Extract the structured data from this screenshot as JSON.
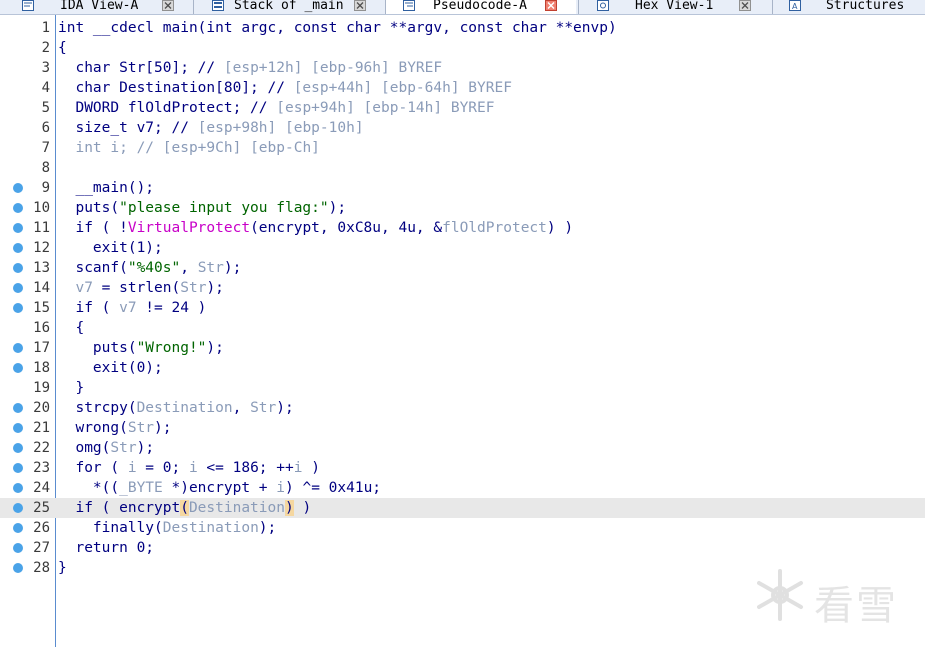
{
  "tabs": [
    {
      "label": "IDA View-A",
      "icon": "disassembly-icon",
      "active": false
    },
    {
      "label": "Stack of _main",
      "icon": "stack-icon",
      "active": false
    },
    {
      "label": "Pseudocode-A",
      "icon": "pseudocode-icon",
      "active": true
    },
    {
      "label": "Hex View-1",
      "icon": "hex-icon",
      "active": false
    },
    {
      "label": "Structures",
      "icon": "structures-icon",
      "active": false
    }
  ],
  "colors": {
    "keyword": "#000080",
    "comment": "#8a9bb8",
    "string": "#006400",
    "import": "#c800c8",
    "breakpoint": "#4aa3e8",
    "gutter_line": "#5a8ccf"
  },
  "code": {
    "line_numbers": [
      "1",
      "2",
      "3",
      "4",
      "5",
      "6",
      "7",
      "8",
      "9",
      "10",
      "11",
      "12",
      "13",
      "14",
      "15",
      "16",
      "17",
      "18",
      "19",
      "20",
      "21",
      "22",
      "23",
      "24",
      "25",
      "26",
      "27",
      "28"
    ],
    "l1": "int __cdecl main(int argc, const char **argv, const char **envp)",
    "l2": "{",
    "l3a": "  char Str[50]; // ",
    "l3b": "[esp+12h] [ebp-96h] BYREF",
    "l4a": "  char Destination[80]; // ",
    "l4b": "[esp+44h] [ebp-64h] BYREF",
    "l5a": "  DWORD flOldProtect; // ",
    "l5b": "[esp+94h] [ebp-14h] BYREF",
    "l6a": "  size_t v7; // ",
    "l6b": "[esp+98h] [ebp-10h]",
    "l7a": "  int i; // ",
    "l7b": "[esp+9Ch] [ebp-Ch]",
    "l9": "  __main();",
    "l10a": "  puts(",
    "l10b": "\"please input you flag:\"",
    "l10c": ");",
    "l11a": "  if ( !",
    "l11b": "VirtualProtect",
    "l11c": "(encrypt, 0xC8u, 4u, &",
    "l11d": "flOldProtect",
    "l11e": ") )",
    "l12": "    exit(1);",
    "l13a": "  scanf(",
    "l13b": "\"%40s\"",
    "l13c": ", ",
    "l13d": "Str",
    "l13e": ");",
    "l14a": "  ",
    "l14b": "v7",
    "l14c": " = strlen(",
    "l14d": "Str",
    "l14e": ");",
    "l15a": "  if ( ",
    "l15b": "v7",
    "l15c": " != 24 )",
    "l16": "  {",
    "l17a": "    puts(",
    "l17b": "\"Wrong!\"",
    "l17c": ");",
    "l18": "    exit(0);",
    "l19": "  }",
    "l20a": "  strcpy(",
    "l20b": "Destination",
    "l20c": ", ",
    "l20d": "Str",
    "l20e": ");",
    "l21a": "  wrong(",
    "l21b": "Str",
    "l21c": ");",
    "l22a": "  omg(",
    "l22b": "Str",
    "l22c": ");",
    "l23a": "  for ( ",
    "l23b": "i",
    "l23c": " = 0; ",
    "l23d": "i",
    "l23e": " <= 186; ++",
    "l23f": "i",
    "l23g": " )",
    "l24a": "    *((",
    "l24b": "_BYTE",
    "l24c": " *)encrypt + ",
    "l24d": "i",
    "l24e": ") ^= 0x41u;",
    "l25a": "  if ( encrypt",
    "l25b": "(",
    "l25c": "Destination",
    "l25d": ")",
    "l25e": " )",
    "l26a": "    finally(",
    "l26b": "Destination",
    "l26c": ");",
    "l27": "  return 0;",
    "l28": "}"
  },
  "breakpoint_lines": [
    9,
    10,
    11,
    12,
    13,
    14,
    15,
    17,
    18,
    20,
    21,
    22,
    23,
    24,
    25,
    26,
    27,
    28
  ],
  "watermark": {
    "text": "看雪",
    "icon": "snowflake-icon"
  }
}
